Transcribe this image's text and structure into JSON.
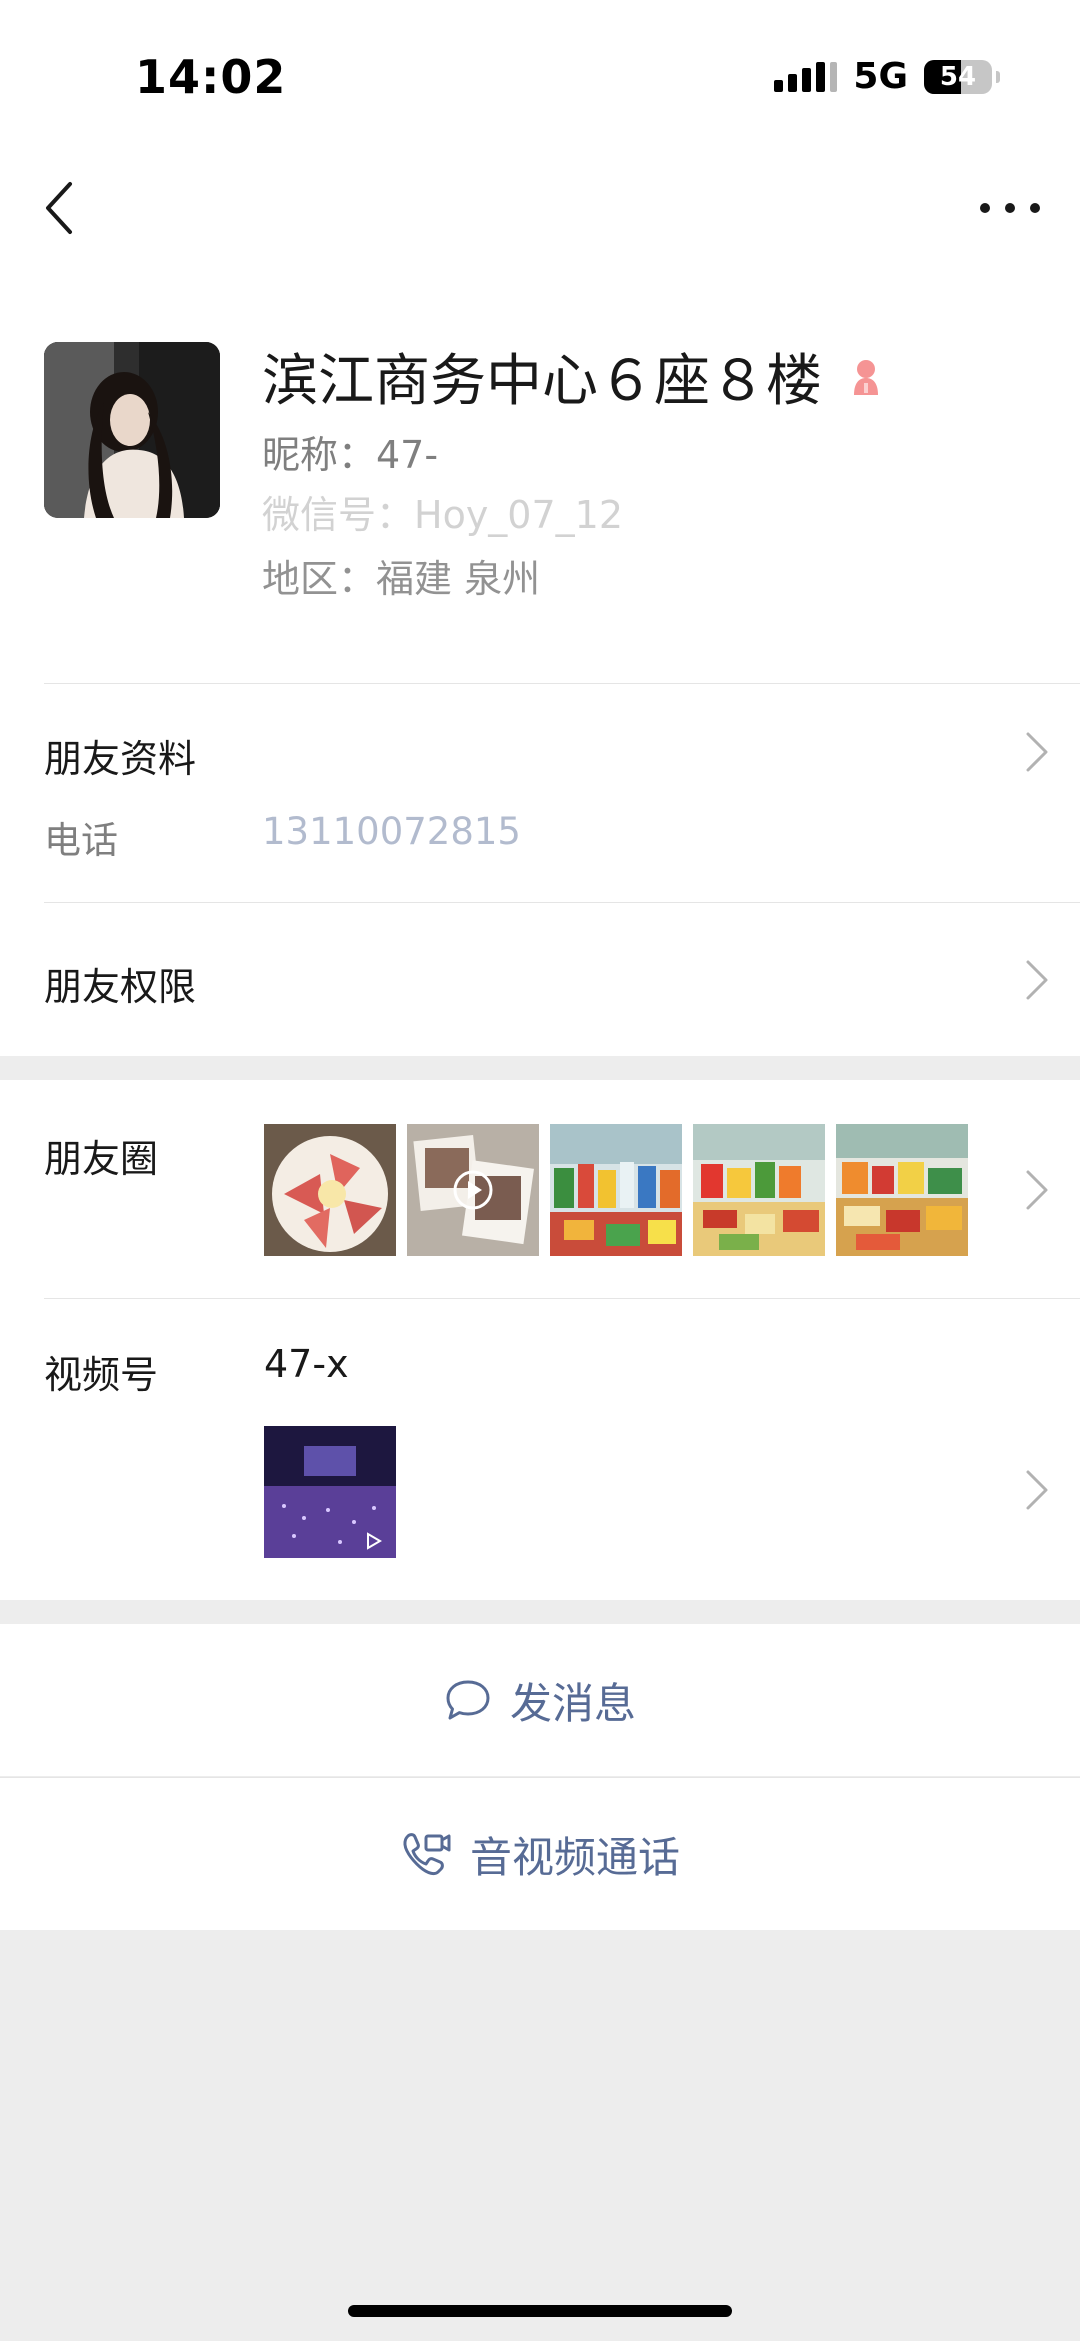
{
  "status_bar": {
    "time": "14:02",
    "network": "5G",
    "battery": "54",
    "battery_level": 0.54
  },
  "nav": {
    "back_icon": "chevron-left-icon",
    "more_icon": "more-dots-icon"
  },
  "profile": {
    "name": "滨江商务中心６座８楼",
    "gender_icon": "female-icon",
    "gender_color": "#fa5151",
    "nickname": "昵称：47-",
    "wechat_id": "微信号：Hoy_07_12",
    "region": "地区：福建  泉州"
  },
  "friend_info": {
    "title": "朋友资料",
    "phone_label": "电话",
    "phone_value": "13110072815"
  },
  "friend_permissions": {
    "title": "朋友权限"
  },
  "moments": {
    "title": "朋友圈",
    "thumbs": [
      "food-photo",
      "video-photo",
      "snacks-photo",
      "snacks-photo",
      "snacks-photo"
    ]
  },
  "channels": {
    "title": "视频号",
    "name": "47-x"
  },
  "actions": {
    "message": "发消息",
    "call": "音视频通话"
  },
  "colors": {
    "link": "#576b95",
    "background": "#ededed"
  }
}
